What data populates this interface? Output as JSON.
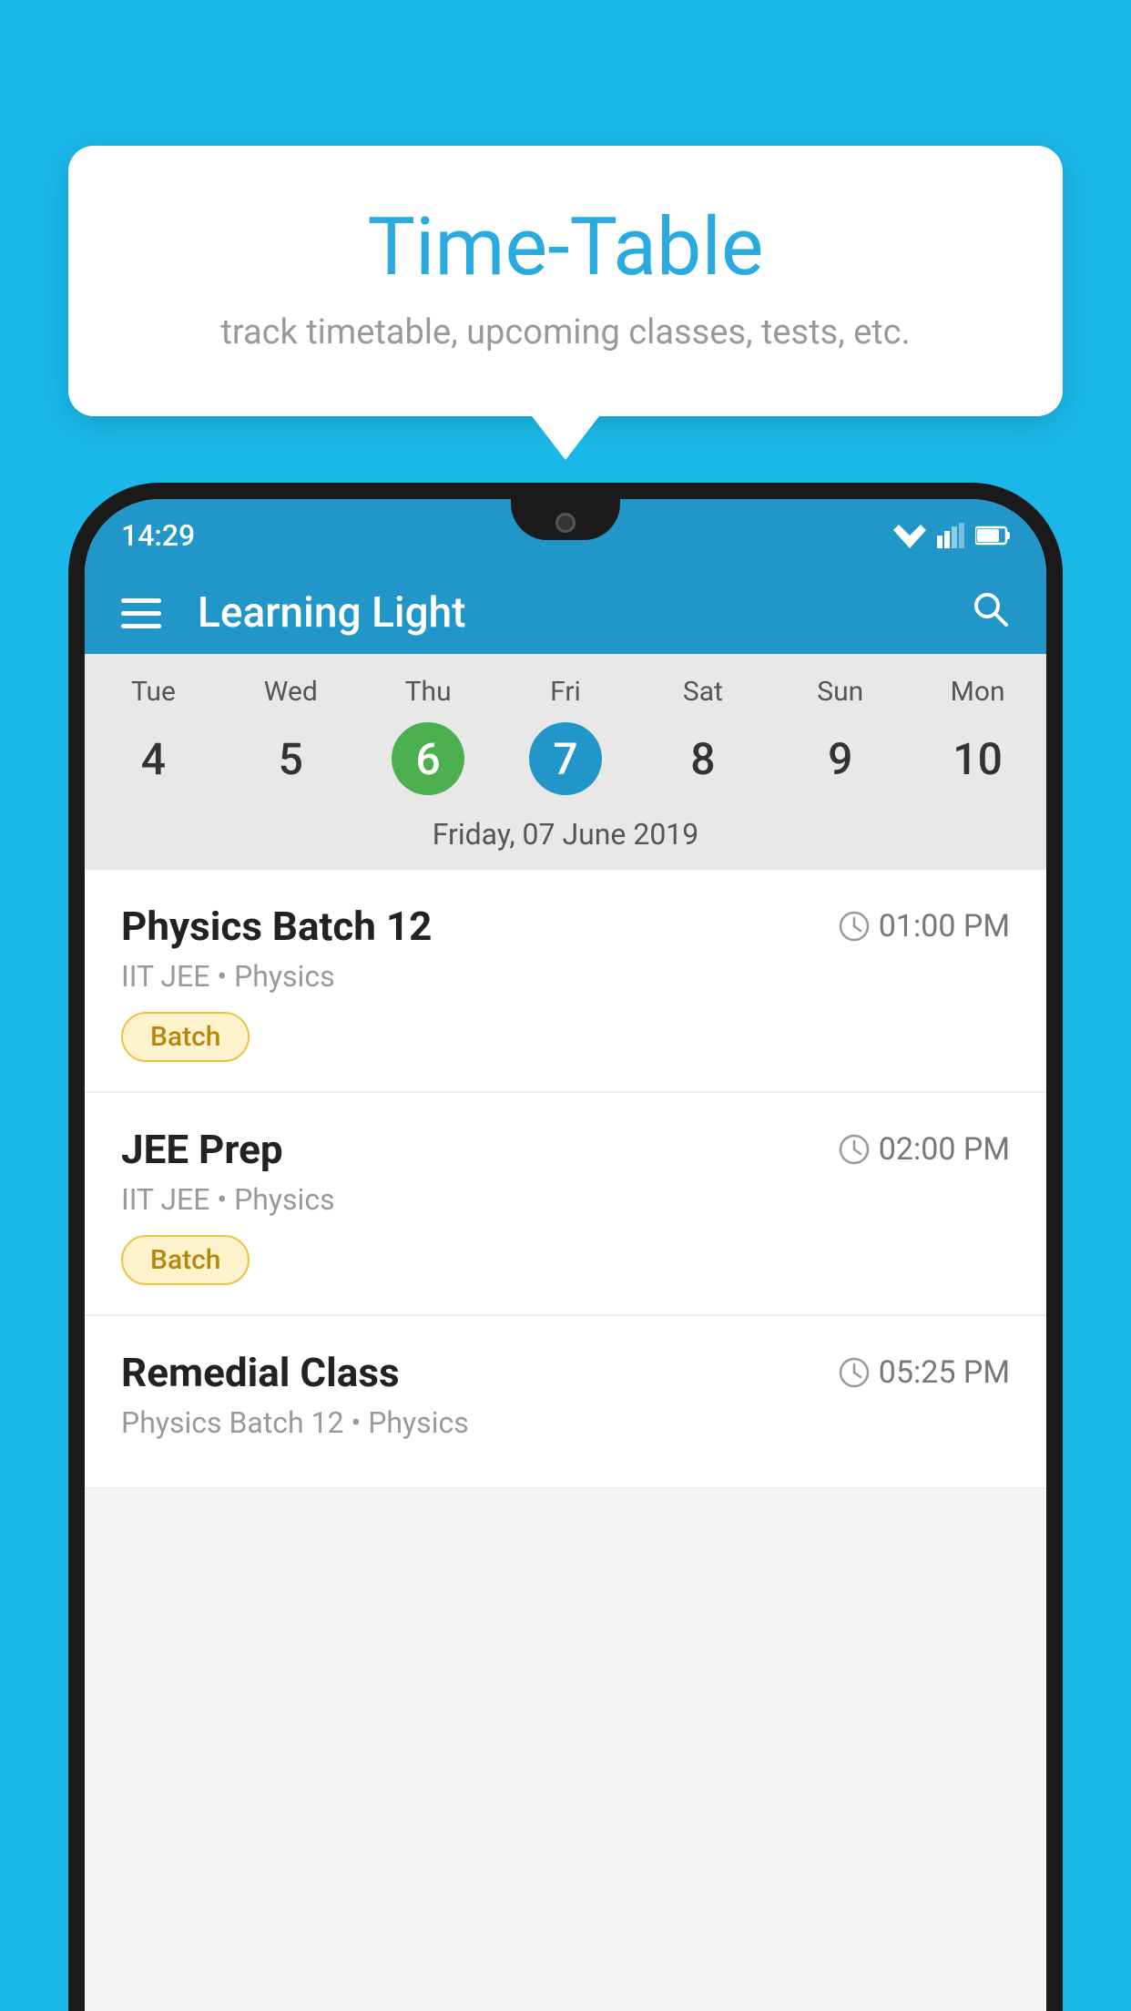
{
  "background_color": "#1ab8e8",
  "tooltip": {
    "title": "Time-Table",
    "subtitle": "track timetable, upcoming classes, tests, etc."
  },
  "phone": {
    "status_bar": {
      "time": "14:29"
    },
    "header": {
      "title": "Learning Light",
      "hamburger_label": "menu",
      "search_label": "search"
    },
    "calendar": {
      "days": [
        {
          "name": "Tue",
          "num": "4",
          "state": "normal"
        },
        {
          "name": "Wed",
          "num": "5",
          "state": "normal"
        },
        {
          "name": "Thu",
          "num": "6",
          "state": "today"
        },
        {
          "name": "Fri",
          "num": "7",
          "state": "selected"
        },
        {
          "name": "Sat",
          "num": "8",
          "state": "normal"
        },
        {
          "name": "Sun",
          "num": "9",
          "state": "normal"
        },
        {
          "name": "Mon",
          "num": "10",
          "state": "normal"
        }
      ],
      "selected_date_label": "Friday, 07 June 2019"
    },
    "schedule_items": [
      {
        "title": "Physics Batch 12",
        "time": "01:00 PM",
        "subtitle": "IIT JEE • Physics",
        "badge": "Batch"
      },
      {
        "title": "JEE Prep",
        "time": "02:00 PM",
        "subtitle": "IIT JEE • Physics",
        "badge": "Batch"
      },
      {
        "title": "Remedial Class",
        "time": "05:25 PM",
        "subtitle": "Physics Batch 12 • Physics",
        "badge": null
      }
    ]
  }
}
